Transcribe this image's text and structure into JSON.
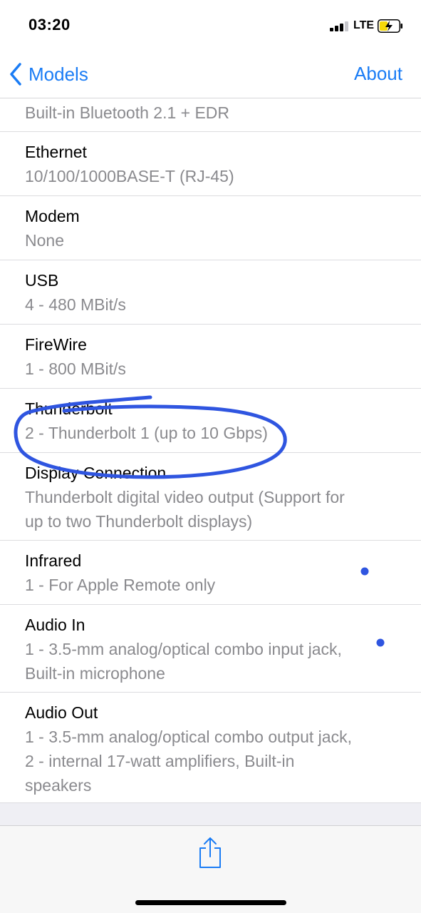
{
  "status_bar": {
    "time": "03:20",
    "network": "LTE",
    "signal_bars_filled": 3,
    "signal_bars_total": 4,
    "battery_state": "charging"
  },
  "nav": {
    "back_label": "Models",
    "back_icon": "chevron-left-icon",
    "action_label": "About"
  },
  "specs": {
    "partial_value": "Built-in Bluetooth 2.1 + EDR",
    "items": [
      {
        "title": "Ethernet",
        "value": "10/100/1000BASE-T (RJ-45)"
      },
      {
        "title": "Modem",
        "value": "None"
      },
      {
        "title": "USB",
        "value": "4 - 480 MBit/s"
      },
      {
        "title": "FireWire",
        "value": "1 - 800 MBit/s"
      },
      {
        "title": "Thunderbolt",
        "value": "2 - Thunderbolt 1 (up to 10 Gbps)"
      },
      {
        "title": "Display Connection",
        "value_lines": [
          "Thunderbolt digital video output (Support for",
          "up to two Thunderbolt displays)"
        ]
      },
      {
        "title": "Infrared",
        "value": "1 - For Apple Remote only"
      },
      {
        "title": "Audio In",
        "value_lines": [
          "1 - 3.5-mm analog/optical combo input jack,",
          "Built-in microphone"
        ]
      },
      {
        "title": "Audio Out",
        "value_lines": [
          "1 - 3.5-mm analog/optical combo output jack,",
          "2 - internal 17-watt amplifiers, Built-in",
          "speakers"
        ]
      }
    ]
  },
  "toolbar": {
    "share_icon": "share-icon"
  },
  "colors": {
    "accent": "#1a7cf5",
    "secondary_text": "#8a8a8e",
    "annotation_ink": "#2f55e0",
    "battery_fill": "#f5d90a"
  }
}
